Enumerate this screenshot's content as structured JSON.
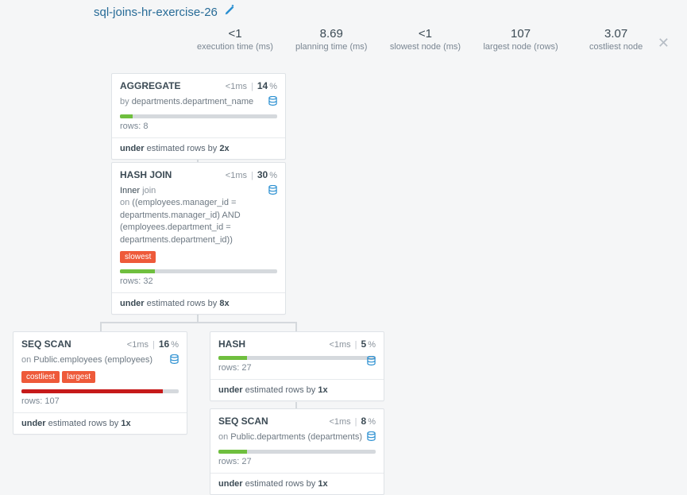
{
  "title": "sql-joins-hr-exercise-26",
  "stats": {
    "exec_time": {
      "val": "<1",
      "lbl": "execution time (ms)"
    },
    "plan_time": {
      "val": "8.69",
      "lbl": "planning time (ms)"
    },
    "slowest": {
      "val": "<1",
      "lbl": "slowest node (ms)"
    },
    "largest": {
      "val": "107",
      "lbl": "largest node (rows)"
    },
    "costliest": {
      "val": "3.07",
      "lbl": "costliest node"
    }
  },
  "nodes": {
    "agg": {
      "name": "AGGREGATE",
      "time": "<1ms",
      "pct": "14",
      "detail_prefix": "by ",
      "detail": "departments.department_name",
      "bar_color": "green",
      "bar_pct": 8,
      "rows": "rows: 8",
      "footer_bold1": "under",
      "footer_mid": " estimated rows by ",
      "footer_bold2": "2x"
    },
    "hashjoin": {
      "name": "HASH JOIN",
      "time": "<1ms",
      "pct": "30",
      "detail_strong": "Inner",
      "detail_kw": " join",
      "detail_prefix": "on ",
      "detail": "((employees.manager_id = departments.manager_id) AND (employees.department_id = departments.department_id))",
      "tag1": "slowest",
      "bar_color": "green",
      "bar_pct": 22,
      "rows": "rows: 32",
      "footer_bold1": "under",
      "footer_mid": " estimated rows by ",
      "footer_bold2": "8x"
    },
    "seq1": {
      "name": "SEQ SCAN",
      "time": "<1ms",
      "pct": "16",
      "detail_prefix": "on ",
      "detail": "Public.employees (employees)",
      "tag1": "costliest",
      "tag2": "largest",
      "bar_color": "red",
      "bar_pct": 90,
      "rows": "rows: 107",
      "footer_bold1": "under",
      "footer_mid": " estimated rows by ",
      "footer_bold2": "1x"
    },
    "hash": {
      "name": "HASH",
      "time": "<1ms",
      "pct": "5",
      "bar_color": "green",
      "bar_pct": 18,
      "rows": "rows: 27",
      "footer_bold1": "under",
      "footer_mid": " estimated rows by ",
      "footer_bold2": "1x"
    },
    "seq2": {
      "name": "SEQ SCAN",
      "time": "<1ms",
      "pct": "8",
      "detail_prefix": "on ",
      "detail": "Public.departments (departments)",
      "bar_color": "green",
      "bar_pct": 18,
      "rows": "rows: 27",
      "footer_bold1": "under",
      "footer_mid": " estimated rows by ",
      "footer_bold2": "1x"
    }
  }
}
